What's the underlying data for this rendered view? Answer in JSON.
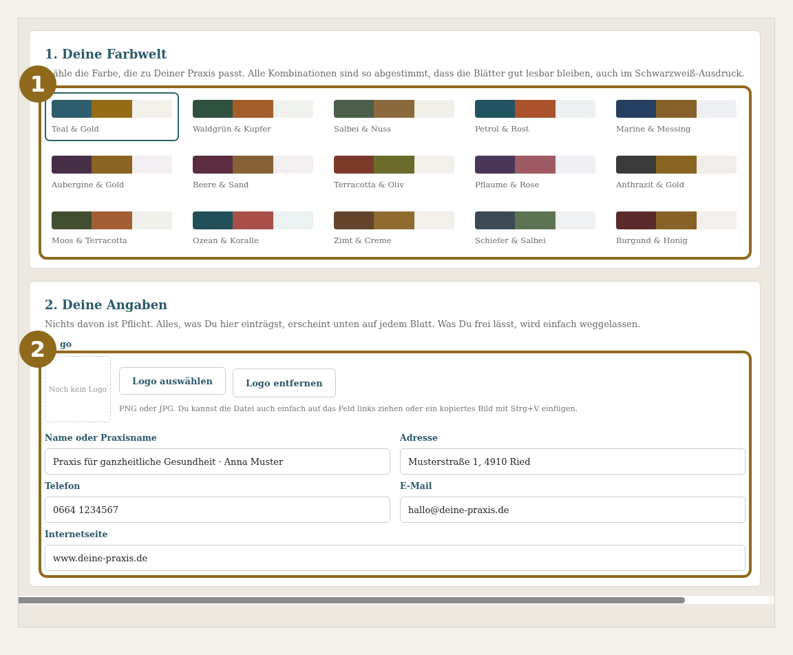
{
  "sections": [
    {
      "title": "1. Deine Farbwelt",
      "description": "ähle die Farbe, die zu Deiner Praxis passt. Alle Kombinationen sind so abgestimmt, dass die Blätter gut lesbar bleiben, auch im Schwarzweiß-Ausdruck.",
      "marker": "1"
    },
    {
      "title": "2. Deine Angaben",
      "description": "Nichts davon ist Pflicht. Alles, was Du hier einträgst, erscheint unten auf jedem Blatt. Was Du frei lässt, wird einfach weggelassen.",
      "marker": "2"
    }
  ],
  "palettes": [
    {
      "name": "Teal & Gold",
      "selected": true,
      "swatches": [
        {
          "color": "#2e5e6e"
        },
        {
          "color": "#946b17"
        },
        {
          "color": "#f3f0ea"
        }
      ]
    },
    {
      "name": "Waldgrün & Kupfer",
      "selected": false,
      "swatches": [
        {
          "color": "#2f5240"
        },
        {
          "color": "#a55d2b"
        },
        {
          "color": "#eff1ed"
        }
      ]
    },
    {
      "name": "Salbei & Nuss",
      "selected": false,
      "swatches": [
        {
          "color": "#4a5e4a"
        },
        {
          "color": "#8a6a3c"
        },
        {
          "color": "#f0efea"
        }
      ]
    },
    {
      "name": "Petrol & Rost",
      "selected": false,
      "swatches": [
        {
          "color": "#215460"
        },
        {
          "color": "#a9522b"
        },
        {
          "color": "#edf0f1"
        }
      ]
    },
    {
      "name": "Marine & Messing",
      "selected": false,
      "swatches": [
        {
          "color": "#263f60"
        },
        {
          "color": "#866129"
        },
        {
          "color": "#eeeff2"
        }
      ]
    },
    {
      "name": "Aubergine & Gold",
      "selected": false,
      "swatches": [
        {
          "color": "#472f4a"
        },
        {
          "color": "#8a6421"
        },
        {
          "color": "#f2eef1"
        }
      ]
    },
    {
      "name": "Beere & Sand",
      "selected": false,
      "swatches": [
        {
          "color": "#5b2b3f"
        },
        {
          "color": "#866137"
        },
        {
          "color": "#f3eef0"
        }
      ]
    },
    {
      "name": "Terracotta & Oliv",
      "selected": false,
      "swatches": [
        {
          "color": "#7b3b2b"
        },
        {
          "color": "#6b6b2b"
        },
        {
          "color": "#f3efea"
        }
      ]
    },
    {
      "name": "Pflaume & Rose",
      "selected": false,
      "swatches": [
        {
          "color": "#4a3656"
        },
        {
          "color": "#9e5b63"
        },
        {
          "color": "#efeef2"
        }
      ]
    },
    {
      "name": "Anthrazit & Gold",
      "selected": false,
      "swatches": [
        {
          "color": "#3a3a3a"
        },
        {
          "color": "#8a6421"
        },
        {
          "color": "#f0edea"
        }
      ]
    },
    {
      "name": "Moos & Terracotta",
      "selected": false,
      "swatches": [
        {
          "color": "#424f2f"
        },
        {
          "color": "#a35e36"
        },
        {
          "color": "#f0f0eb"
        }
      ]
    },
    {
      "name": "Ozean & Koralle",
      "selected": false,
      "swatches": [
        {
          "color": "#214f5a"
        },
        {
          "color": "#a74f48"
        },
        {
          "color": "#ecf1f1"
        }
      ]
    },
    {
      "name": "Zimt & Creme",
      "selected": false,
      "swatches": [
        {
          "color": "#63432b"
        },
        {
          "color": "#8f6b30"
        },
        {
          "color": "#f3efea"
        }
      ]
    },
    {
      "name": "Schiefer & Salbei",
      "selected": false,
      "swatches": [
        {
          "color": "#3b4a55"
        },
        {
          "color": "#5d7452"
        },
        {
          "color": "#eef0f1"
        }
      ]
    },
    {
      "name": "Burgund & Honig",
      "selected": false,
      "swatches": [
        {
          "color": "#5b2a2b"
        },
        {
          "color": "#876126"
        },
        {
          "color": "#f3efec"
        }
      ]
    }
  ],
  "logo": {
    "label": "go",
    "placeholder": "Noch kein Logo",
    "buttons": [
      "Logo auswählen",
      "Logo entfernen"
    ],
    "hint": "PNG oder JPG. Du kannst die Datei auch einfach auf das Feld links ziehen oder ein kopiertes Bild mit Strg+V einfügen."
  },
  "fields": [
    {
      "label": "Name oder Praxisname",
      "value": "Praxis für ganzheitliche Gesundheit · Anna Muster",
      "wide": false
    },
    {
      "label": "Adresse",
      "value": "Musterstraße 1, 4910 Ried",
      "wide": false
    },
    {
      "label": "Telefon",
      "value": "0664 1234567",
      "wide": false
    },
    {
      "label": "E-Mail",
      "value": "hallo@deine-praxis.de",
      "wide": false
    },
    {
      "label": "Internetseite",
      "value": "www.deine-praxis.de",
      "wide": true
    }
  ]
}
